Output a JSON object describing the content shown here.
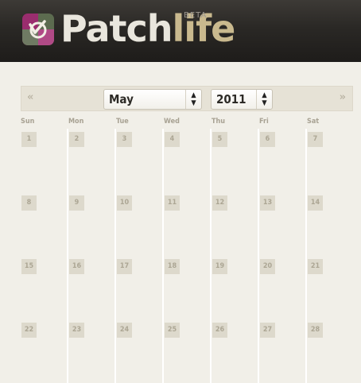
{
  "header": {
    "brand_part1": "Patch",
    "brand_part2": "life",
    "badge": "BETA"
  },
  "nav": {
    "prev_symbol": "«",
    "next_symbol": "»",
    "month": "May",
    "year": "2011",
    "spinner_up": "▲",
    "spinner_down": "▼"
  },
  "weekdays": [
    "Sun",
    "Mon",
    "Tue",
    "Wed",
    "Thu",
    "Fri",
    "Sat"
  ],
  "weeks": [
    [
      "1",
      "2",
      "3",
      "4",
      "5",
      "6",
      "7"
    ],
    [
      "8",
      "9",
      "10",
      "11",
      "12",
      "13",
      "14"
    ],
    [
      "15",
      "16",
      "17",
      "18",
      "19",
      "20",
      "21"
    ],
    [
      "22",
      "23",
      "24",
      "25",
      "26",
      "27",
      "28"
    ]
  ],
  "colors": {
    "header_bg": "#2a2825",
    "page_bg": "#f1efe8",
    "day_box": "#ddd9cc",
    "brand_accent": "#c9b98e",
    "logo_magenta": "#9a2d6e"
  }
}
